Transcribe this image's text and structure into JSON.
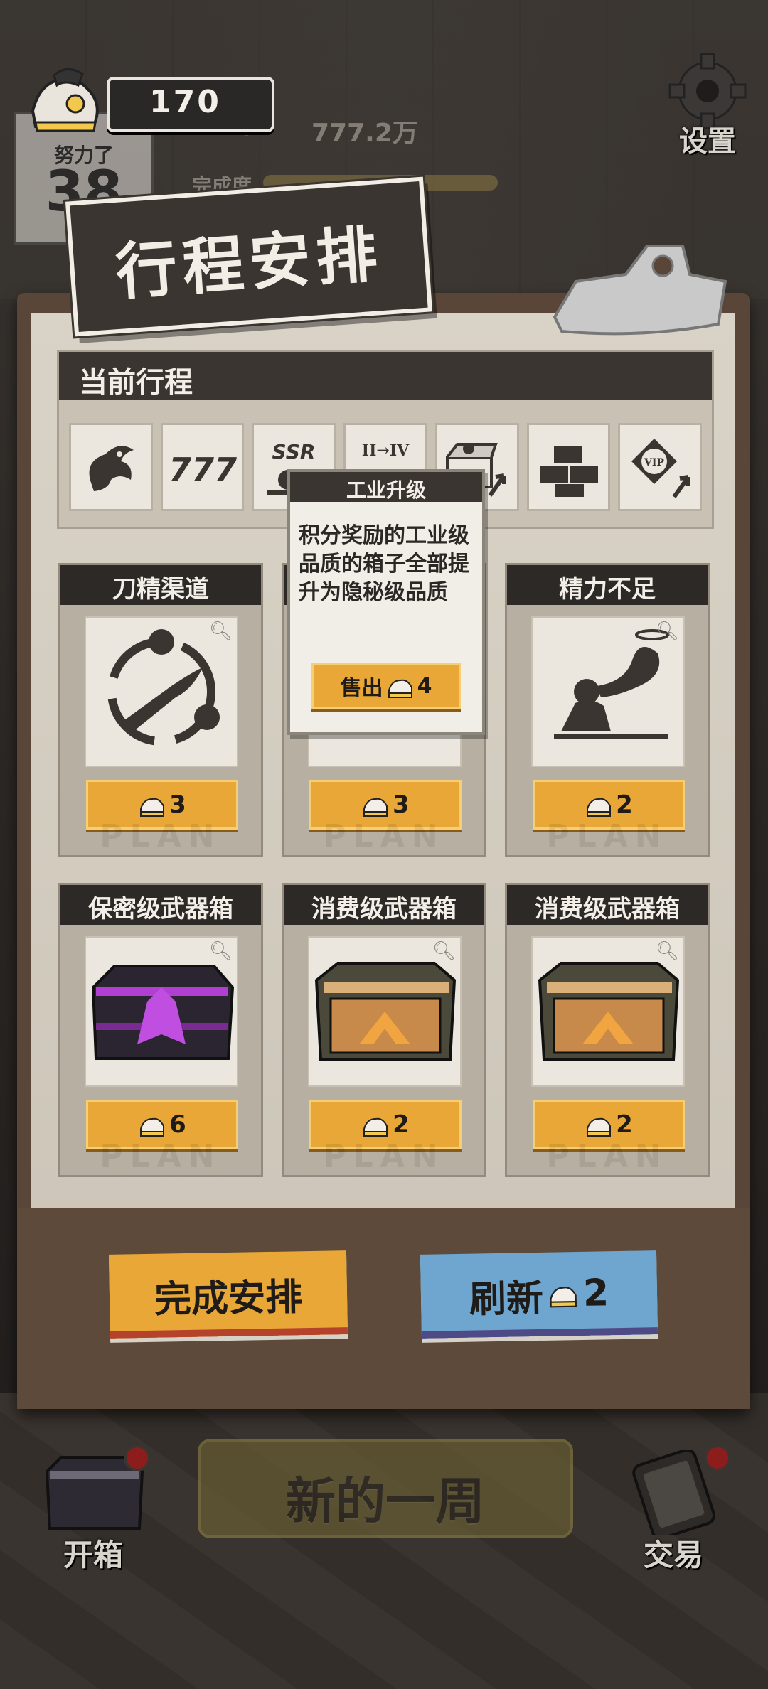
{
  "top_bar": {
    "coin_count": "170",
    "settings_label": "设置"
  },
  "background_stats": {
    "coin": "170",
    "cash": "777.2万",
    "progress_label": "完成度",
    "effort_label": "努力了",
    "effort_value": "38"
  },
  "title": "行程安排",
  "current_schedule": {
    "header": "当前行程",
    "icons": [
      "dragon-icon",
      "triple-seven-icon",
      "ssr-icon",
      "tier-upgrade-icon",
      "box-upgrade-icon",
      "crates-icon",
      "vip-upgrade-icon"
    ],
    "icon_texts": {
      "ssr": "SSR",
      "tier": "II→IV",
      "vip": "VIP"
    }
  },
  "cards": [
    {
      "title": "刀精渠道",
      "price": "3",
      "art": "knife-icon"
    },
    {
      "title": "",
      "price": "3",
      "art": "hidden-card-art"
    },
    {
      "title": "精力不足",
      "price": "2",
      "art": "ghost-icon"
    },
    {
      "title": "保密级武器箱",
      "price": "6",
      "art": "purple-crate-icon"
    },
    {
      "title": "消费级武器箱",
      "price": "2",
      "art": "wooden-crate-icon"
    },
    {
      "title": "消费级武器箱",
      "price": "2",
      "art": "wooden-crate-icon"
    }
  ],
  "tooltip": {
    "title": "工业升级",
    "description": "积分奖励的工业级品质的箱子全部提升为隐秘级品质",
    "sell_label": "售出",
    "sell_price": "4"
  },
  "actions": {
    "complete_label": "完成安排",
    "refresh_label": "刷新",
    "refresh_cost": "2"
  },
  "bottom_nav": {
    "open_box_label": "开箱",
    "new_week_label": "新的一周",
    "trade_label": "交易"
  },
  "colors": {
    "accent_orange": "#e8a737",
    "accent_blue": "#6ea6cf",
    "dark_header": "#3a3531",
    "paper": "#d8d2c6"
  }
}
